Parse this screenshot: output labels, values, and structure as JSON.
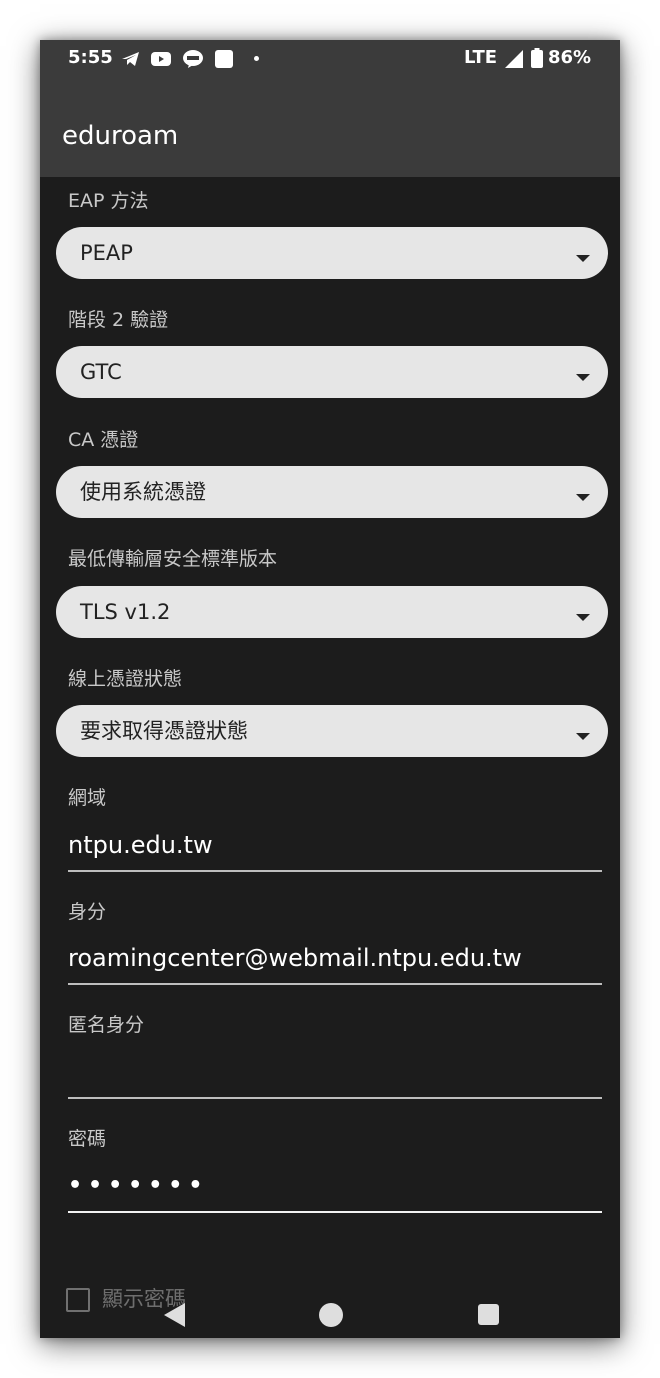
{
  "status_bar": {
    "time": "5:55",
    "network": "LTE",
    "battery": "86%",
    "notification_icons": [
      "telegram-icon",
      "youtube-icon",
      "line-icon",
      "app-square-icon"
    ]
  },
  "app_bar": {
    "title": "eduroam"
  },
  "form": {
    "eap_method": {
      "label": "EAP 方法",
      "value": "PEAP"
    },
    "phase2_auth": {
      "label": "階段 2 驗證",
      "value": "GTC"
    },
    "ca_cert": {
      "label": "CA 憑證",
      "value": "使用系統憑證"
    },
    "min_tls": {
      "label": "最低傳輸層安全標準版本",
      "value": "TLS v1.2"
    },
    "ocsp": {
      "label": "線上憑證狀態",
      "value": "要求取得憑證狀態"
    },
    "domain": {
      "label": "網域",
      "value": "ntpu.edu.tw"
    },
    "identity": {
      "label": "身分",
      "value": "roamingcenter@webmail.ntpu.edu.tw"
    },
    "anonymous_identity": {
      "label": "匿名身分",
      "value": ""
    },
    "password": {
      "label": "密碼",
      "value": "•••••••"
    },
    "show_password": {
      "label": "顯示密碼",
      "checked": false
    }
  },
  "nav_bar": {
    "buttons": [
      "back-icon",
      "home-icon",
      "recents-icon"
    ]
  },
  "colors": {
    "background": "#1c1c1c",
    "app_bar": "#3b3b3b",
    "dropdown": "#e6e6e6",
    "text_primary": "#ffffff",
    "text_label": "#c8c8c8"
  }
}
